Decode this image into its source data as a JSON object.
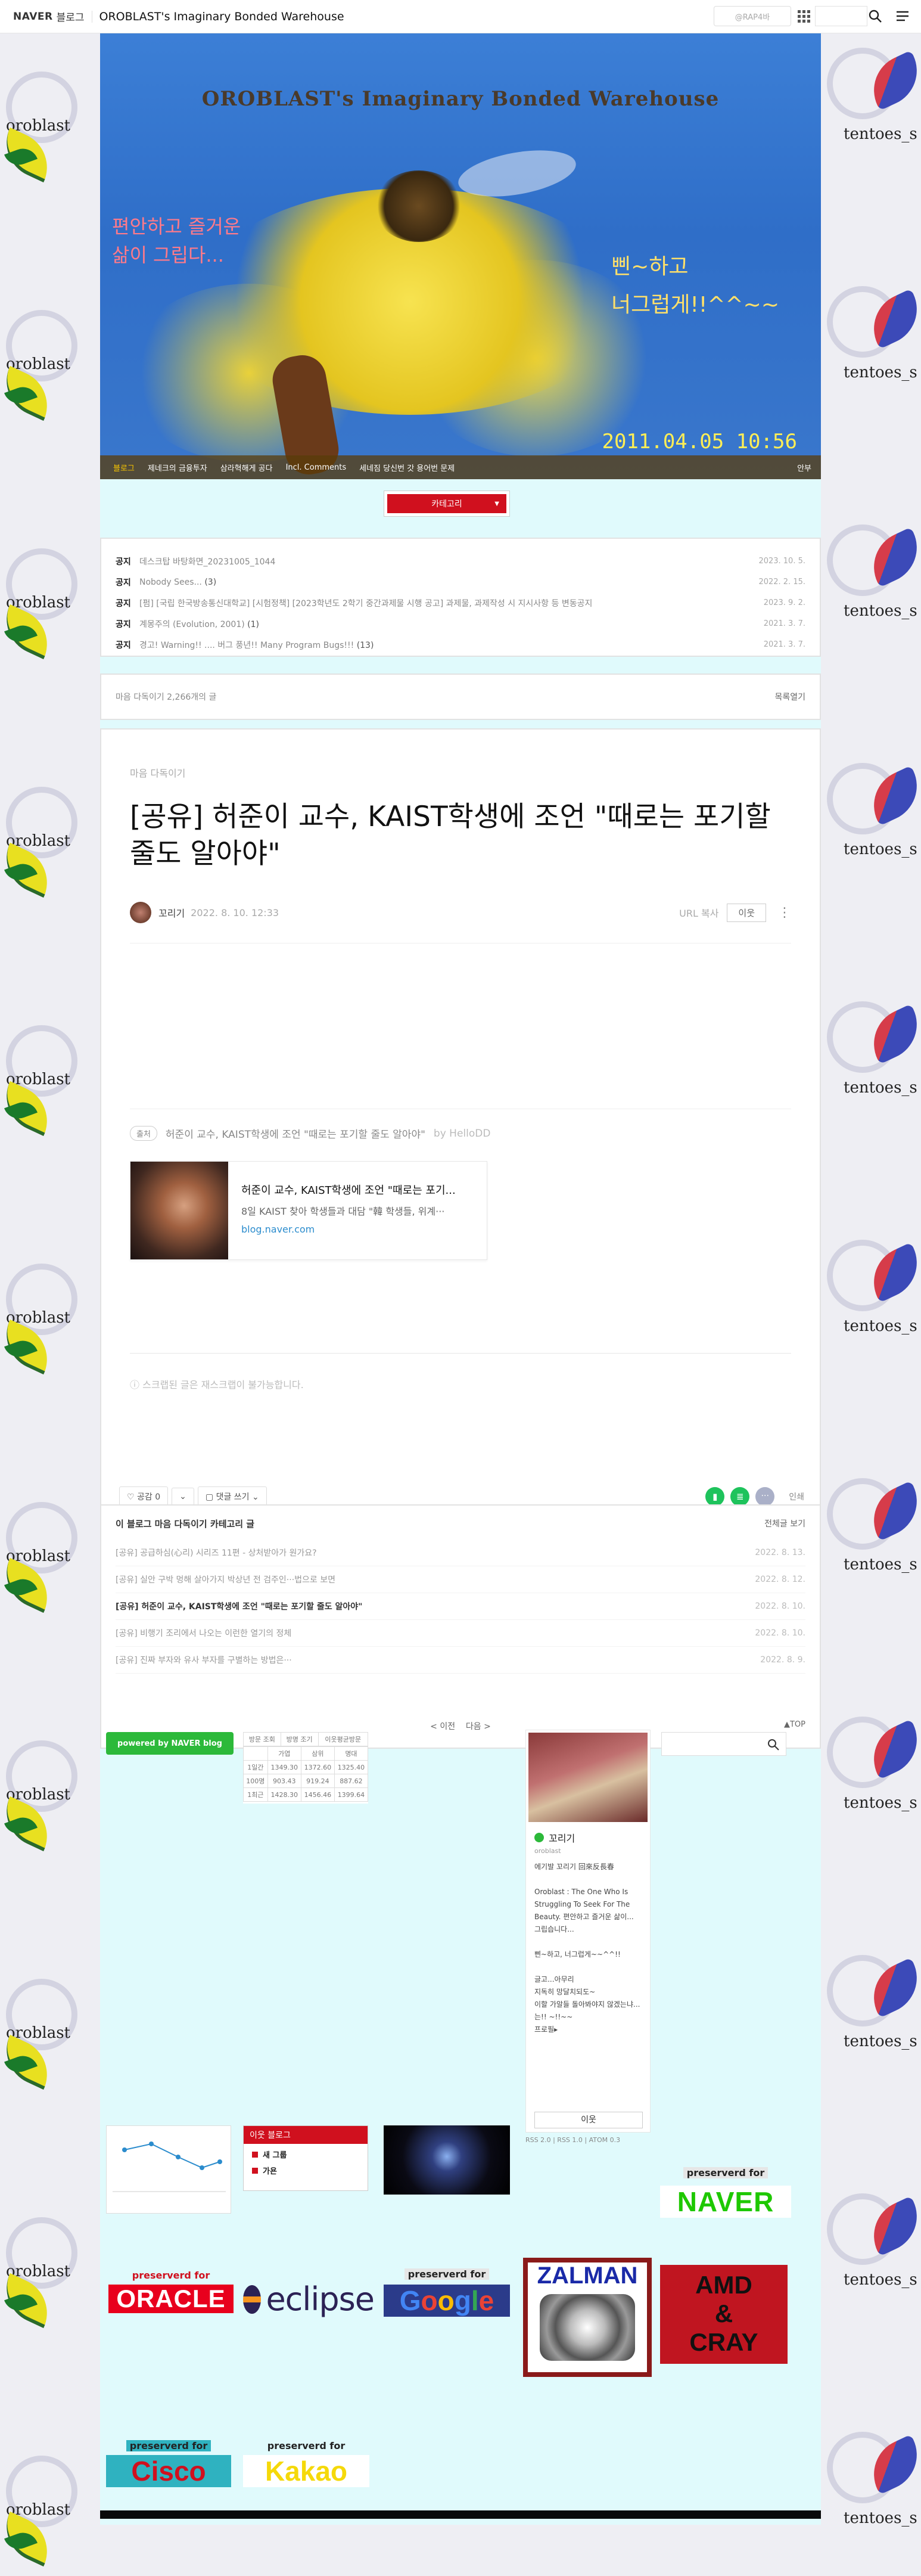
{
  "topbar": {
    "logo": "NAVER",
    "logo2": "블로그",
    "title": "OROBLAST's Imaginary Bonded Warehouse",
    "ad_placeholder": "@RAP4바",
    "icons": [
      "grid-icon",
      "search-icon",
      "menu-icon"
    ]
  },
  "header": {
    "title": "OROBLAST's Imaginary Bonded Warehouse",
    "phrase_left_1": "편안하고 즐거운",
    "phrase_left_2": "삶이 그립다...",
    "phrase_right_1": "삔~하고",
    "phrase_right_2": "너그럽게!!^^~~",
    "datestamp": "2011.04.05 10:56",
    "menu": [
      "블로그",
      "제네크의 금융투자",
      "삼라혁해게 공다",
      "Incl. Comments",
      "세네짐 당신번 갓 용어번 문제"
    ],
    "menu_prof": "안부"
  },
  "category": {
    "label": "카테고리"
  },
  "notices": [
    {
      "tag": "공지",
      "title": "데스크탑 바탕화면_20231005_1044",
      "count": "",
      "date": "2023. 10. 5."
    },
    {
      "tag": "공지",
      "title": "Nobody Sees...",
      "count": "(3)",
      "date": "2022. 2. 15."
    },
    {
      "tag": "공지",
      "title": "[펌] [국립 한국방송통신대학교] [시험정책] [2023학년도 2학기 중간과제물 시행 공고] 과제물, 과제작성 시 지시사항 등 변동공지",
      "count": "",
      "date": "2023. 9. 2."
    },
    {
      "tag": "공지",
      "title": "계몽주의 (Evolution, 2001)",
      "count": "(1)",
      "date": "2021. 3. 7."
    },
    {
      "tag": "공지",
      "title": "경고! Warning!! .... 버그 풍년!! Many Program Bugs!!!",
      "count": "(13)",
      "date": "2021. 3. 7."
    }
  ],
  "listbar": {
    "left": "마음 다독이기 2,266개의 글",
    "right": "목록열기"
  },
  "post": {
    "category": "마음 다독이기",
    "title": "[공유] 허준이 교수, KAIST학생에 조언 \"때로는 포기할 줄도 알아야\"",
    "author": "꼬리기",
    "date": "2022. 8. 10. 12:33",
    "url_copy": "URL 복사",
    "neighbor": "이웃",
    "more": "⋮",
    "source_tag": "출처",
    "source_title": "허준이 교수, KAIST학생에 조언 \"때로는 포기할 줄도 알아야\"",
    "source_by": "by HelloDD",
    "card_title": "허준이 교수, KAIST학생에 조언 \"때로는 포기...",
    "card_desc": "8일 KAIST 찾아 학생들과 대담 \"韓 학생들, 위계···",
    "card_link": "blog.naver.com",
    "copy_notice": "스크랩된 글은 재스크랩이 불가능합니다.",
    "like": "공감 0",
    "comment": "댓글 쓰기",
    "print": "인쇄"
  },
  "related": {
    "header": "이 블로그 마음 다독이기 카테고리 글",
    "all": "전체글 보기",
    "items": [
      {
        "title": "[공유] 공급하심(心리) 시리즈 11편 - 상처받아가 원가요?",
        "date": "2022. 8. 13.",
        "current": false
      },
      {
        "title": "[공유] 실안 구박 멍해 살아가지 박상년 전 검주인···법으로 보면",
        "date": "2022. 8. 12.",
        "current": false
      },
      {
        "title": "[공유] 허준이 교수, KAIST학생에 조언 \"때로는 포기할 줄도 알아야\"",
        "date": "2022. 8. 10.",
        "current": true
      },
      {
        "title": "[공유] 비행기 조리에서 나오는 이런한 열기의 정체",
        "date": "2022. 8. 10.",
        "current": false
      },
      {
        "title": "[공유] 진짜 부자와 유사 부자를 구별하는 방법은···",
        "date": "2022. 8. 9.",
        "current": false
      }
    ],
    "prev": "< 이전",
    "next": "다음 >",
    "top": "▲TOP"
  },
  "sidebar": {
    "powered": "powered by NAVER blog",
    "stats_head": [
      "방문 조회",
      "방명 조기",
      "이웃평균방문"
    ],
    "stats_rows": [
      [
        "",
        "가엽",
        "삼위",
        "명대"
      ],
      [
        "1일간",
        "1349.30",
        "1372.60",
        "1325.40"
      ],
      [
        "100명",
        "903.43",
        "919.24",
        "887.62"
      ],
      [
        "1최근",
        "1428.30",
        "1456.46",
        "1399.64"
      ]
    ],
    "profile_name": "꼬리기",
    "profile_id": "oroblast",
    "profile_text": "에기발 꼬리기 回來反長春\n\nOroblast : The One Who Is Struggling To Seek For The Beauty.  편안하고 즐거운 삶이...\n           그립습니다...\n\n삔~하고, 너그럽게~~^^!!\n\n글고...아무리\n지독히 망달치되도~\n이할 가알들 돌아봐야지 않겠는냐...는!! ~!!~~\n프로필▸",
    "profile_neighbor": "이웃",
    "rss": "RSS 2.0  |  RSS 1.0  |  ATOM 0.3"
  },
  "widgets": {
    "menu_title": "이웃 블로그",
    "menu_items": [
      "새 그룹",
      "가욘"
    ]
  },
  "brands": {
    "naver_label": "preserverd for",
    "naver": "NAVER",
    "oracle_label": "preserverd for",
    "oracle": "ORACLE",
    "eclipse": "eclipse",
    "google_label": "preserverd for",
    "google": "Google",
    "zalman": "ZALMAN",
    "amd_1": "AMD",
    "amd_2": "&",
    "amd_3": "CRAY",
    "cisco_label": "preserverd for",
    "cisco": "Cisco",
    "kakao_label": "preserverd for",
    "kakao": "Kakao"
  },
  "background": {
    "left_text": "oroblast",
    "right_text": "tentoes_s"
  }
}
